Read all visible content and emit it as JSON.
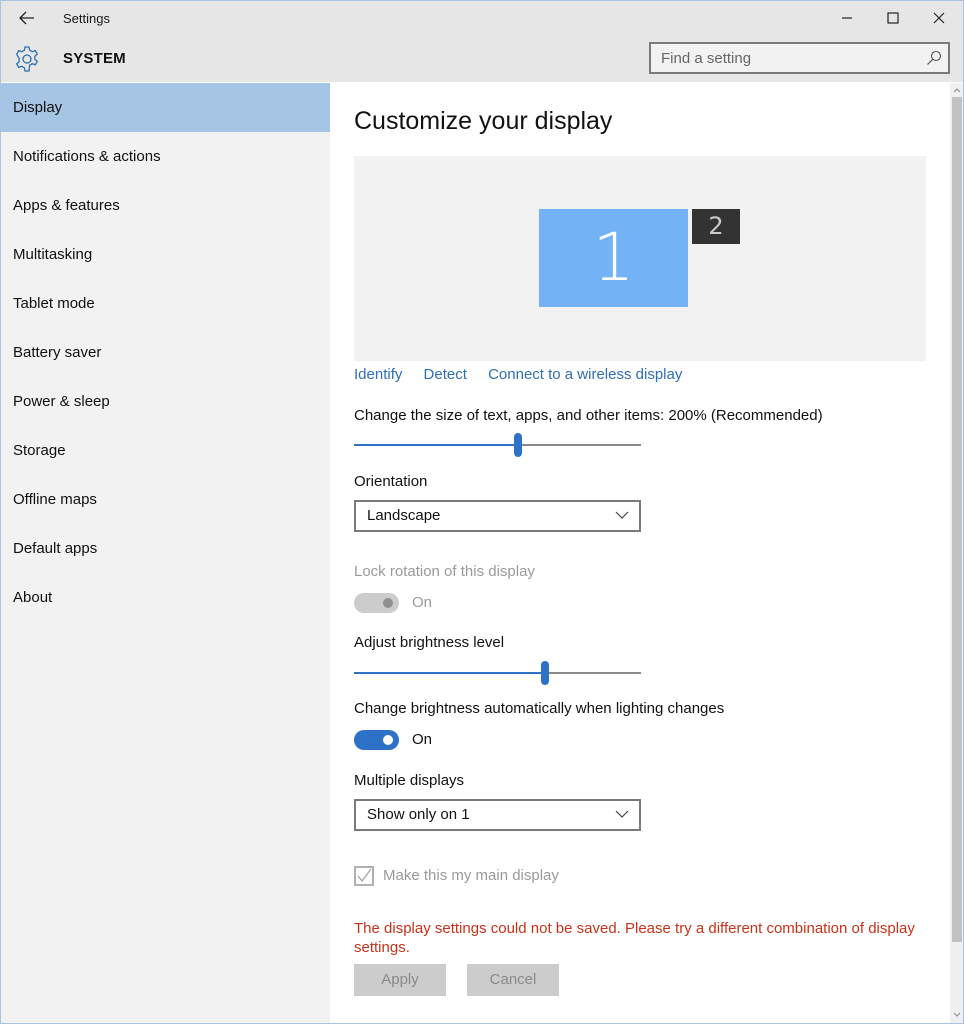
{
  "window": {
    "app_title": "Settings",
    "controls": {
      "minimize": "minimize-icon",
      "maximize": "maximize-icon",
      "close": "close-icon"
    }
  },
  "header": {
    "section_title": "SYSTEM",
    "section_icon": "gear-icon",
    "search": {
      "placeholder": "Find a setting",
      "value": ""
    }
  },
  "sidebar": {
    "items": [
      {
        "label": "Display",
        "active": true
      },
      {
        "label": "Notifications & actions"
      },
      {
        "label": "Apps & features"
      },
      {
        "label": "Multitasking"
      },
      {
        "label": "Tablet mode"
      },
      {
        "label": "Battery saver"
      },
      {
        "label": "Power & sleep"
      },
      {
        "label": "Storage"
      },
      {
        "label": "Offline maps"
      },
      {
        "label": "Default apps"
      },
      {
        "label": "About"
      }
    ]
  },
  "main": {
    "title": "Customize your display",
    "monitors": [
      {
        "label": "1",
        "selected": true,
        "color": "#73b3f5"
      },
      {
        "label": "2",
        "selected": false,
        "color": "#333333"
      }
    ],
    "links": {
      "identify": "Identify",
      "detect": "Detect",
      "wireless": "Connect to a wireless display"
    },
    "scale": {
      "label": "Change the size of text, apps, and other items: 200% (Recommended)",
      "value_fraction": 0.57
    },
    "orientation": {
      "label": "Orientation",
      "selected": "Landscape"
    },
    "lock_rotation": {
      "label": "Lock rotation of this display",
      "state": "On",
      "enabled": false
    },
    "brightness": {
      "label": "Adjust brightness level",
      "value_fraction": 0.665
    },
    "auto_brightness": {
      "label": "Change brightness automatically when lighting changes",
      "state": "On",
      "enabled": true
    },
    "multiple_displays": {
      "label": "Multiple displays",
      "selected": "Show only on 1"
    },
    "main_display": {
      "label": "Make this my main display",
      "checked": true,
      "enabled": false
    },
    "error_message": "The display settings could not be saved. Please try a different combination of display settings.",
    "buttons": {
      "apply": "Apply",
      "cancel": "Cancel"
    }
  },
  "colors": {
    "accent": "#2e72c8",
    "link": "#2e6fb5",
    "error": "#c8321a",
    "sidebar_active": "#a6c4e4"
  }
}
